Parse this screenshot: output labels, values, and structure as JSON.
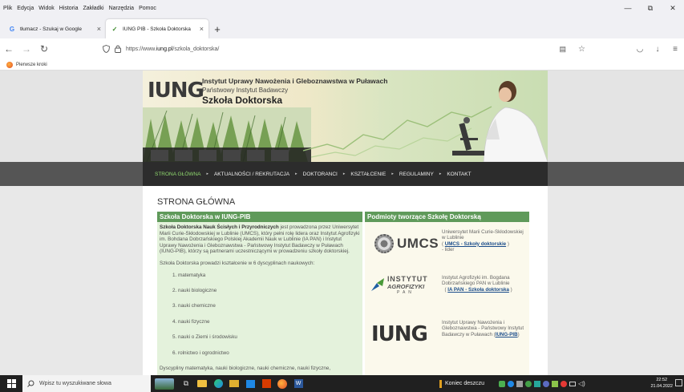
{
  "menubar": {
    "items": [
      "Plik",
      "Edycja",
      "Widok",
      "Historia",
      "Zakładki",
      "Narzędzia",
      "Pomoc"
    ],
    "window_controls": [
      "—",
      "⧉",
      "✕"
    ]
  },
  "tabs": [
    {
      "favicon": "G",
      "title": "tłumacz - Szukaj w Google",
      "close": "×",
      "active": false
    },
    {
      "favicon": "✓",
      "title": "IUNG PIB - Szkoła Doktorska",
      "close": "×",
      "active": true
    }
  ],
  "new_tab": "+",
  "navbar": {
    "back": "←",
    "forward": "→",
    "reload": "↻",
    "url_prefix": "https://www.",
    "url_host": "iung.pl",
    "url_path": "/szkola_doktorska/",
    "reader_icon": "▤",
    "star_icon": "☆",
    "pocket_icon": "◡",
    "download_icon": "↓",
    "menu_icon": "≡"
  },
  "bookmarks": {
    "item": "Pierwsze kroki"
  },
  "banner": {
    "logo": "IUNG",
    "institute": "Instytut Uprawy Nawożenia i Gleboznawstwa w Puławach",
    "subtitle": "Państwowy Instytut Badawczy",
    "school": "Szkoła Doktorska"
  },
  "site_nav": [
    "STRONA GŁÓWNA",
    "AKTUALNOŚCI / REKRUTACJA",
    "DOKTORANCI",
    "KSZTAŁCENIE",
    "REGULAMINY",
    "KONTAKT"
  ],
  "site_nav_sep": "▸",
  "content": {
    "page_title": "STRONA GŁÓWNA",
    "left_header": "Szkoła Doktorska w IUNG-PIB",
    "intro_bold": "Szkoła Doktorska Nauk Ścisłych i Przyrodniczych",
    "intro_rest": " jest prowadzona przez Uniwersytet Marii Curie-Skłodowskiej w Lublinie (UMCS), który pełni rolę lidera oraz Instytut Agrofizyki im. Bohdana Dobrzańskiego Polskiej Akademii Nauk w Lublinie (IA PAN) i Instytut Uprawy Nawożenia i Gleboznawstwa - Państwowy Instytut Badawczy w Puławach (IUNG-PIB), którzy są partnerami uczestniczącymi w prowadzeniu szkoły doktorskiej.",
    "disciplines_intro": "Szkoła Doktorska prowadzi kształcenie w 6 dyscyplinach naukowych:",
    "disciplines": [
      "1. matematyka",
      "2. nauki biologiczne",
      "3. nauki chemiczne",
      "4. nauki fizyczne",
      "5. nauki o Ziemi i środowisku",
      "6. rolnictwo i ogrodnictwo"
    ],
    "footer_text": "Dyscypliny matematyka, nauki biologiczne, nauki chemiczne, nauki fizyczne,",
    "right_header": "Podmioty tworzące Szkołę Doktorską",
    "entities": [
      {
        "logo": "UMCS",
        "text": "Uniwersytet Marii Curie-Skłodowskiej w Lublinie",
        "link": "UMCS - Szkoły doktorskie",
        "suffix": "- lider"
      },
      {
        "logo_l1": "INSTYTUT",
        "logo_l2": "AGROFIZYKI",
        "logo_l3": "PAN",
        "text": "Instytut Agrofizyki im. Bogdana Dobrzańskiego PAN w Lublinie",
        "link": "IA PAN - Szkoła doktorska"
      },
      {
        "logo": "IUNG",
        "text": "Instytut Uprawy Nawożenia i Gleboznawstwa - Państwowy Instytut Badawczy w Puławach (",
        "link": "IUNG-PIB",
        "suffix": ")"
      }
    ]
  },
  "taskbar": {
    "search_placeholder": "Wpisz tu wyszukiwane słowa",
    "weather": "Koniec deszczu",
    "time": "22:52",
    "date": "21.04.2022"
  }
}
